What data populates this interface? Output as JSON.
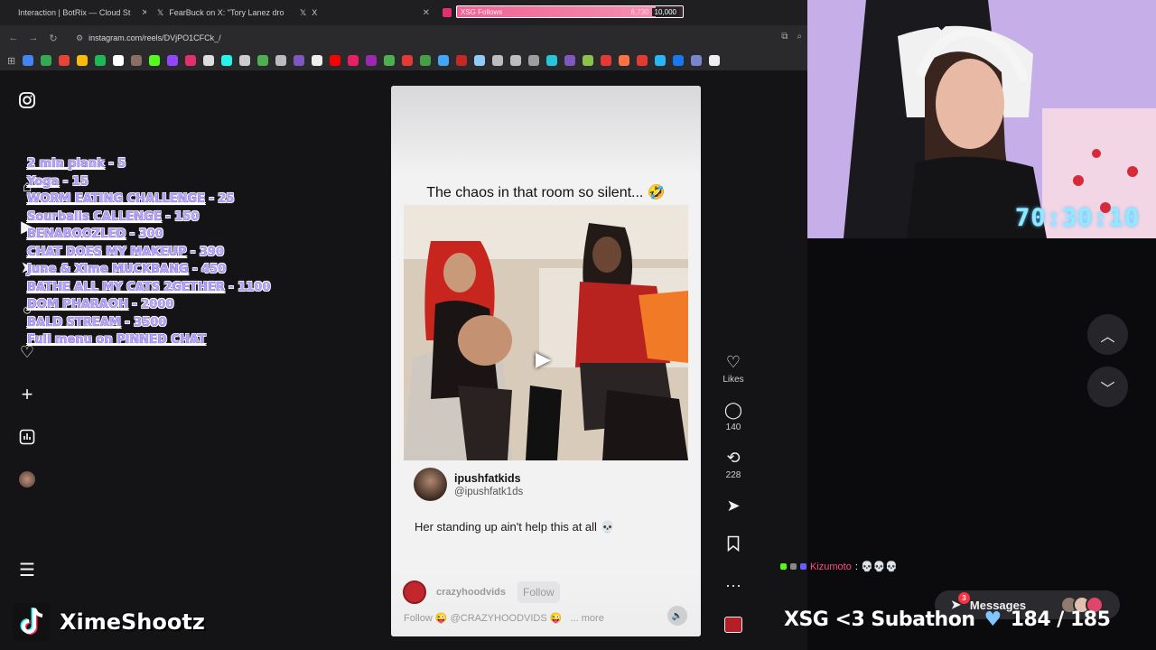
{
  "tabs": [
    {
      "label": "Interaction | BotRix — Cloud St",
      "fav": "#bbbbbb"
    },
    {
      "label": "FearBuck on X: \"Tory Lanez dro",
      "fav": "#ffffff"
    },
    {
      "label": "X",
      "fav": "#ffffff"
    },
    {
      "label": "",
      "fav": "#e1306c"
    }
  ],
  "goal_widget": {
    "label": "XSG Follows",
    "current": "8,730",
    "max": "10,000",
    "progress": 0.873
  },
  "address": {
    "url": "instagram.com/reels/DVjPO1CFCk_/"
  },
  "menu_items": [
    {
      "task": "2 min plank",
      "price": "5"
    },
    {
      "task": "Yoga",
      "price": "15"
    },
    {
      "task": "WORM EATING CHALLENGE",
      "price": "25"
    },
    {
      "task": "Sourballs CALLENGE",
      "price": "150"
    },
    {
      "task": "BENABOOZLED",
      "price": "300"
    },
    {
      "task": "CHAT DOES MY MAKEUP",
      "price": "390"
    },
    {
      "task": "June & Xime MUCKBANG",
      "price": "450"
    },
    {
      "task": "BATHE ALL MY CATS 2GETHER",
      "price": "1100"
    },
    {
      "task": "DOM PHARAOH",
      "price": "2000"
    },
    {
      "task": "BALD STREAM",
      "price": "3500"
    },
    {
      "task": "Full menu on PINNED CHAT",
      "price": ""
    }
  ],
  "reel": {
    "caption": "The chaos in that room so silent... 🤣",
    "author_name": "ipushfatkids",
    "author_handle": "@ipushfatk1ds",
    "text": "Her standing up ain't help this at all 💀",
    "channel": "crazyhoodvids",
    "follow_label": "Follow",
    "description": "Follow 😜 @CRAZYHOODVIDS 😜",
    "more_label": "... more"
  },
  "actions": {
    "likes_label": "Likes",
    "comments": "140",
    "reposts": "228"
  },
  "stream": {
    "timer": "70:30:10",
    "streamer_name": "XimeShootz",
    "chat_user": "Kizumoto",
    "chat_message": ": 💀💀💀",
    "subathon_text": "XSG <3 Subathon",
    "subathon_count": "184 / 185",
    "messages_label": "Messages",
    "messages_badge": "3"
  },
  "colors": {
    "menu_text": "#b9a7ff",
    "timer": "#8fe9ff",
    "instagram_pink": "#e1306c",
    "chat_user": "#ff4f7b"
  }
}
